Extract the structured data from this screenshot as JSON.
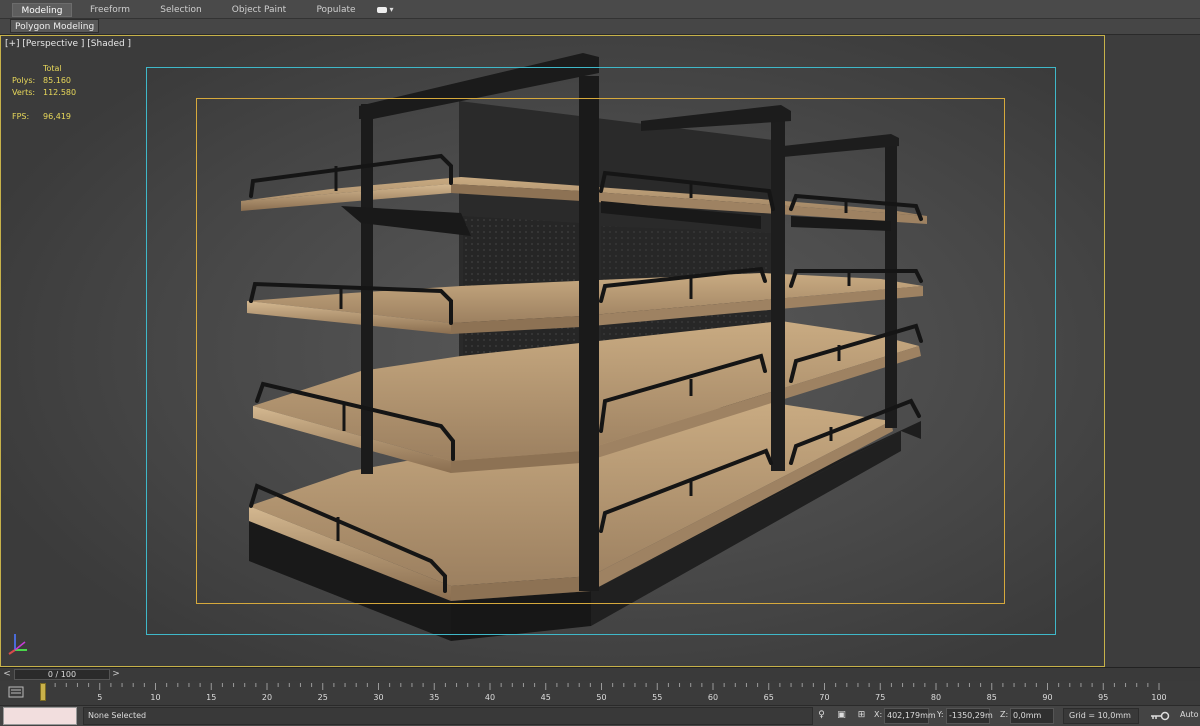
{
  "ribbon": {
    "tabs": [
      {
        "label": "Modeling",
        "active": true
      },
      {
        "label": "Freeform",
        "active": false
      },
      {
        "label": "Selection",
        "active": false
      },
      {
        "label": "Object Paint",
        "active": false
      },
      {
        "label": "Populate",
        "active": false
      }
    ],
    "subtab": "Polygon Modeling"
  },
  "viewport": {
    "label": "[+] [Perspective ] [Shaded ]",
    "stats": {
      "header": "Total",
      "polys_label": "Polys:",
      "polys_value": "85.160",
      "verts_label": "Verts:",
      "verts_value": "112.580",
      "fps_label": "FPS:",
      "fps_value": "96,419"
    },
    "viewcube_icon": "viewcube-icon",
    "colors": {
      "safe_frame": "#3fb8c9",
      "action_frame": "#d6a93c",
      "viewport_border": "#c7b24a",
      "shelf_wood": "#b89a72",
      "metal": "#1c1c1c"
    }
  },
  "timeline": {
    "slider_value": "0 / 100",
    "prev_label": "<",
    "next_label": ">",
    "ticks": [
      "5",
      "10",
      "15",
      "20",
      "25",
      "30",
      "35",
      "40",
      "45",
      "50",
      "55",
      "60",
      "65",
      "70",
      "75",
      "80",
      "85",
      "90",
      "95",
      "100"
    ]
  },
  "status": {
    "selection": "None Selected",
    "x_label": "X:",
    "x_value": "402,179mm",
    "y_label": "Y:",
    "y_value": "-1350,29m",
    "z_label": "Z:",
    "z_value": "0,0mm",
    "grid": "Grid = 10,0mm",
    "auto": "Auto"
  }
}
